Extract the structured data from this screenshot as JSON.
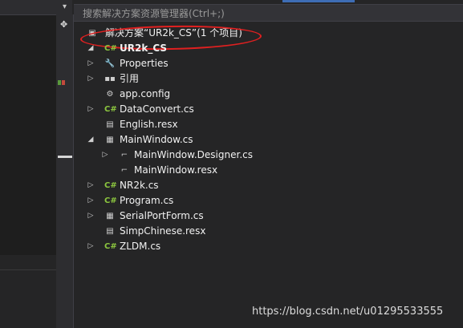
{
  "search": {
    "placeholder": "搜索解决方案资源管理器(Ctrl+;)"
  },
  "solution": {
    "label": "解决方案“UR2k_CS”(1 个项目)"
  },
  "project": {
    "name": "UR2k_CS"
  },
  "tree": [
    {
      "id": "properties",
      "label": "Properties",
      "icon": "wrench-icon",
      "expandable": true,
      "expanded": false,
      "level": 1
    },
    {
      "id": "references",
      "label": "引用",
      "icon": "references-icon",
      "expandable": true,
      "expanded": false,
      "level": 1
    },
    {
      "id": "app-config",
      "label": "app.config",
      "icon": "config-icon",
      "expandable": false,
      "level": 1
    },
    {
      "id": "dataconvert",
      "label": "DataConvert.cs",
      "icon": "csharp-icon",
      "expandable": true,
      "expanded": false,
      "level": 1
    },
    {
      "id": "english",
      "label": "English.resx",
      "icon": "resx-icon",
      "expandable": false,
      "level": 1
    },
    {
      "id": "mainwindow",
      "label": "MainWindow.cs",
      "icon": "form-icon",
      "expandable": true,
      "expanded": true,
      "level": 1
    },
    {
      "id": "mainwindow-designer",
      "label": "MainWindow.Designer.cs",
      "icon": "designer-icon",
      "expandable": true,
      "expanded": false,
      "level": 2
    },
    {
      "id": "mainwindow-resx",
      "label": "MainWindow.resx",
      "icon": "designer-icon",
      "expandable": false,
      "level": 2
    },
    {
      "id": "nr2k",
      "label": "NR2k.cs",
      "icon": "csharp-icon",
      "expandable": true,
      "expanded": false,
      "level": 1
    },
    {
      "id": "program",
      "label": "Program.cs",
      "icon": "csharp-icon",
      "expandable": true,
      "expanded": false,
      "level": 1
    },
    {
      "id": "serialportform",
      "label": "SerialPortForm.cs",
      "icon": "form-icon",
      "expandable": true,
      "expanded": false,
      "level": 1
    },
    {
      "id": "simpchinese",
      "label": "SimpChinese.resx",
      "icon": "resx-icon",
      "expandable": false,
      "level": 1
    },
    {
      "id": "zldm",
      "label": "ZLDM.cs",
      "icon": "csharp-icon",
      "expandable": true,
      "expanded": false,
      "level": 1
    }
  ],
  "watermark": {
    "text": "https://blog.csdn.net/u01295533555"
  },
  "colors": {
    "background": "#252526",
    "annotation": "#e02020",
    "csharp": "#8cc63f"
  }
}
